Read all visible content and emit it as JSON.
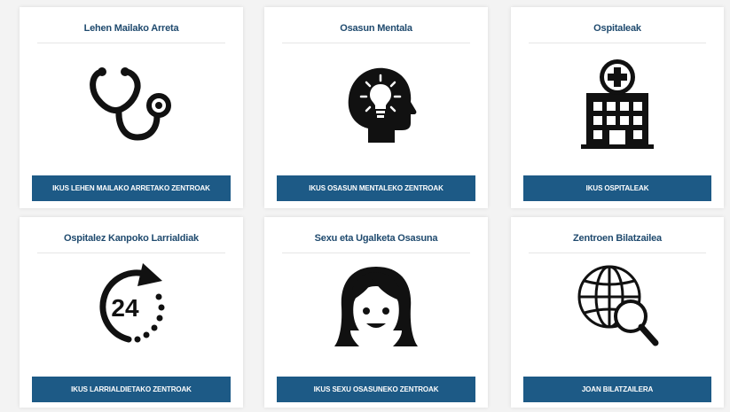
{
  "cards": [
    {
      "title": "Lehen Mailako Arreta",
      "icon": "stethoscope-icon",
      "button": "IKUS LEHEN MAILAKO ARRETAKO ZENTROAK"
    },
    {
      "title": "Osasun Mentala",
      "icon": "head-lightbulb-icon",
      "button": "IKUS OSASUN MENTALEKO ZENTROAK"
    },
    {
      "title": "Ospitaleak",
      "icon": "hospital-icon",
      "button": "IKUS OSPITALEAK"
    },
    {
      "title": "Ospitalez Kanpoko Larrialdiak",
      "icon": "24-hours-icon",
      "button": "IKUS LARRIALDIETAKO ZENTROAK"
    },
    {
      "title": "Sexu eta Ugalketa Osasuna",
      "icon": "girl-face-icon",
      "button": "IKUS SEXU OSASUNEKO ZENTROAK"
    },
    {
      "title": "Zentroen Bilatzailea",
      "icon": "globe-search-icon",
      "button": "JOAN BILATZAILERA"
    }
  ],
  "colors": {
    "button": "#1d5a86",
    "title": "#1f4a6e",
    "background": "#f3f3f3"
  }
}
